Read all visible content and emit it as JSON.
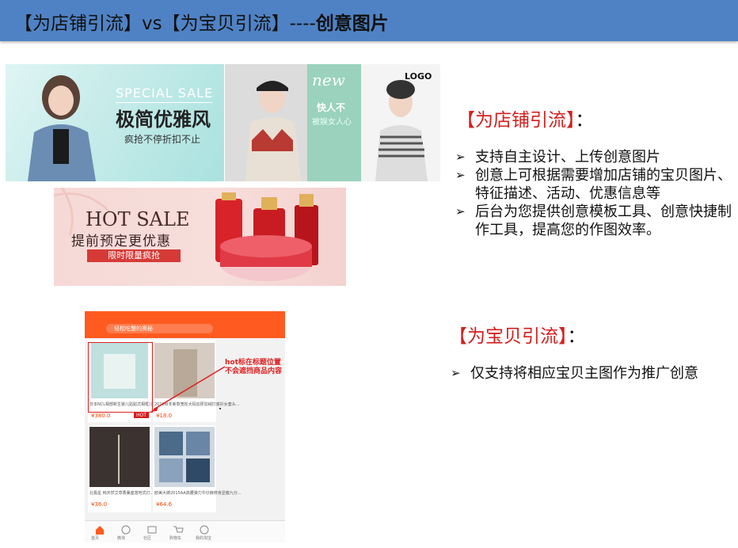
{
  "title": {
    "part1": "【为店铺引流】vs【为宝贝引流】----",
    "part2": "创意图片"
  },
  "banner1": {
    "en": "SPECIAL SALE",
    "headline": "极简优雅风",
    "sub": "疯抢不停折扣不止"
  },
  "banner2": {
    "new": "new",
    "line1": "快人不",
    "line2": "被娱女人心",
    "logo": "LOGO"
  },
  "banner3": {
    "hot": "HOT SALE",
    "sub": "提前预定更优惠",
    "button": "限时限量疯抢"
  },
  "phone": {
    "search_placeholder": "轻松吃蟹的奥秘",
    "item1_caption": "日本NCL相部新生婴儿贴贴式相框儿童DIY相框宝宝成长...",
    "item1_price": "¥380.0",
    "item1_badge": "HOT",
    "item2_caption": "2018秋冬新款宽松大码加厚加绒打底衫女套头...",
    "item2_price": "¥18.0",
    "item3_caption": "北极星 纯天然艾草香薰座落地式灯...",
    "item3_price": "¥36.0",
    "item4_caption": "欧美大牌2015AA高腰弹力牛仔裤修身显瘦九分...",
    "item4_price": "¥64.6",
    "tabs": [
      "首页",
      "微淘",
      "社区",
      "购物车",
      "我的淘宝"
    ],
    "annotation_line1": "hot标在标题位置",
    "annotation_line2": "不会遮挡商品内容"
  },
  "shop": {
    "heading": "【为店铺引流】",
    "colon": "：",
    "bullets": [
      "支持自主设计、上传创意图片",
      "创意上可根据需要增加店铺的宝贝图片、特征描述、活动、优惠信息等",
      "后台为您提供创意模板工具、创意快捷制作工具，提高您的作图效率。"
    ]
  },
  "item": {
    "heading": "【为宝贝引流】",
    "colon": "：",
    "bullets": [
      "仅支持将相应宝贝主图作为推广创意"
    ]
  },
  "colors": {
    "title_bar": "#4f82c4",
    "heading_red": "#d41f1f",
    "phone_orange": "#ff5a1f"
  }
}
